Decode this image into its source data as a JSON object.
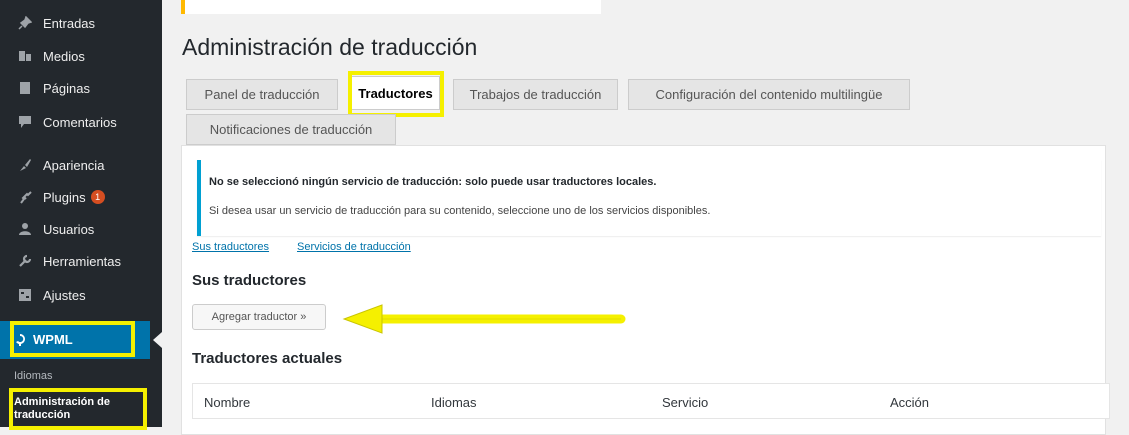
{
  "sidebar": {
    "items": [
      {
        "label": "Entradas",
        "icon": "pin-icon"
      },
      {
        "label": "Medios",
        "icon": "media-icon"
      },
      {
        "label": "Páginas",
        "icon": "page-icon"
      },
      {
        "label": "Comentarios",
        "icon": "comment-icon"
      },
      {
        "label": "Apariencia",
        "icon": "brush-icon"
      },
      {
        "label": "Plugins",
        "icon": "plug-icon",
        "badge": "1"
      },
      {
        "label": "Usuarios",
        "icon": "users-icon"
      },
      {
        "label": "Herramientas",
        "icon": "wrench-icon"
      },
      {
        "label": "Ajustes",
        "icon": "settings-icon"
      }
    ],
    "wpml": {
      "label": "WPML",
      "icon": "wpml-icon"
    },
    "submenu": [
      {
        "label": "Idiomas"
      },
      {
        "label": "Administración de traducción"
      }
    ]
  },
  "page": {
    "title": "Administración de traducción"
  },
  "tabs": [
    {
      "label": "Panel de traducción"
    },
    {
      "label": "Traductores",
      "active": true
    },
    {
      "label": "Trabajos de traducción"
    },
    {
      "label": "Configuración del contenido multilingüe"
    },
    {
      "label": "Notificaciones de traducción"
    }
  ],
  "notice": {
    "bold_text": "No se seleccionó ningún servicio de traducción: solo puede usar traductores locales.",
    "text": "Si desea usar un servicio de traducción para su contenido, seleccione uno de los servicios disponibles."
  },
  "links": {
    "your_translators": "Sus traductores",
    "translation_services": "Servicios de traducción"
  },
  "section": {
    "title": "Sus traductores",
    "add_button": "Agregar traductor »"
  },
  "current": {
    "title": "Traductores actuales",
    "columns": [
      "Nombre",
      "Idiomas",
      "Servicio",
      "Acción"
    ]
  },
  "colors": {
    "highlight": "#f5f000",
    "wp_blue": "#0073aa",
    "sidebar": "#23282d"
  }
}
